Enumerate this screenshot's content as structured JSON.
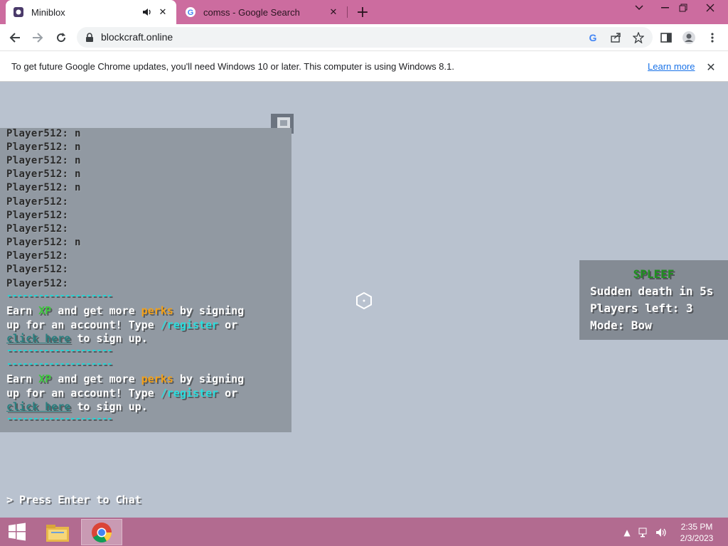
{
  "browser": {
    "tabs": [
      {
        "title": "Miniblox",
        "active": true,
        "icon": "miniblox-favicon",
        "audio_icon": "speaker-icon"
      },
      {
        "title": "comss - Google Search",
        "active": false,
        "icon": "google-favicon"
      }
    ],
    "new_tab_icon": "plus-icon",
    "window_controls": [
      "chevron-down-icon",
      "minimize-icon",
      "restore-icon",
      "close-icon"
    ],
    "url": "blockcraft.online",
    "infobar": {
      "message": "To get future Google Chrome updates, you'll need Windows 10 or later. This computer is using Windows 8.1.",
      "link": "Learn more"
    },
    "colors": {
      "tabstrip": "#cc6c9f",
      "link": "#1a73e8"
    }
  },
  "game": {
    "chat_lines": [
      "Player512: n",
      "Player512: n",
      "Player512: n",
      "Player512: n",
      "Player512: n",
      "Player512:",
      "Player512:",
      "Player512:",
      "Player512: n",
      "Player512:",
      "Player512:",
      "Player512:"
    ],
    "divider": "--------------------",
    "promo": {
      "earn": "Earn",
      "xp": "XP",
      "and_get_more": "and get more",
      "perks": "perks",
      "by_signing": "by signing",
      "up_for": "up for an account! Type",
      "register": "/register",
      "or": "or",
      "click_here": "click here",
      "to_sign_up": "to sign up."
    },
    "scoreboard": {
      "title": "SPLEEF",
      "lines": [
        "Sudden death in 5s",
        "Players left: 3",
        "Mode: Bow"
      ]
    },
    "chat_prompt": "> Press Enter to Chat",
    "colors": {
      "xp": "#3ec63e",
      "perks": "#f2a11a",
      "command": "#2adede",
      "title": "#1f8f1f"
    }
  },
  "taskbar": {
    "apps": [
      "windows-start-icon",
      "file-explorer-icon",
      "chrome-icon"
    ],
    "time": "2:35 PM",
    "date": "2/3/2023"
  }
}
